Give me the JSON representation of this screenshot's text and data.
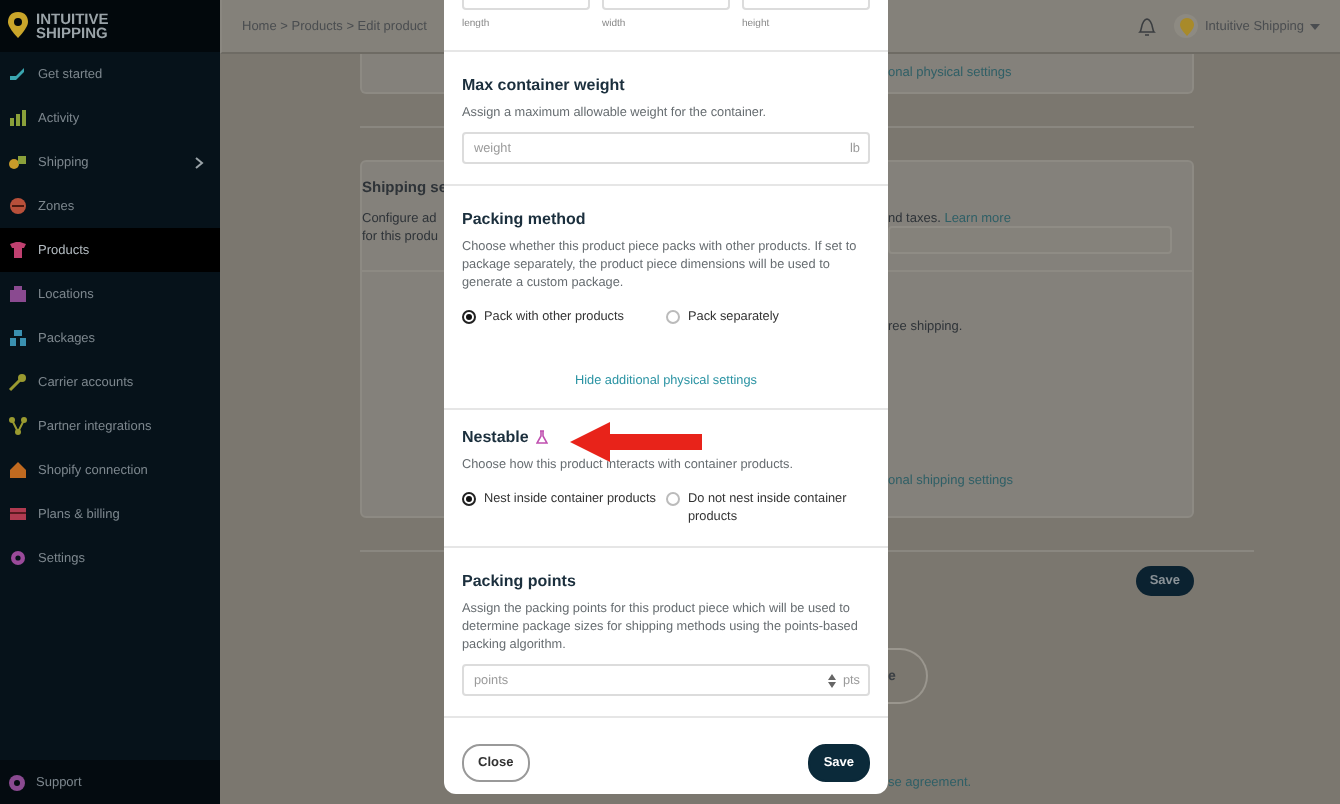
{
  "sidebar": {
    "logo": "INTUITIVE SHIPPING",
    "items": [
      {
        "label": "Get started",
        "selected": false,
        "submenu": false
      },
      {
        "label": "Activity",
        "selected": false,
        "submenu": false
      },
      {
        "label": "Shipping",
        "selected": false,
        "submenu": true
      },
      {
        "label": "Zones",
        "selected": false,
        "submenu": false
      },
      {
        "label": "Products",
        "selected": true,
        "submenu": false
      },
      {
        "label": "Locations",
        "selected": false,
        "submenu": false
      },
      {
        "label": "Packages",
        "selected": false,
        "submenu": false
      },
      {
        "label": "Carrier accounts",
        "selected": false,
        "submenu": false
      },
      {
        "label": "Partner integrations",
        "selected": false,
        "submenu": false
      },
      {
        "label": "Shopify connection",
        "selected": false,
        "submenu": false
      },
      {
        "label": "Plans & billing",
        "selected": false,
        "submenu": false
      },
      {
        "label": "Settings",
        "selected": false,
        "submenu": false
      }
    ],
    "support": "Support"
  },
  "top_bar": {
    "breadcrumb": "Home > Products > Edit product",
    "account": "Intuitive Shipping"
  },
  "background_page": {
    "physical_link": "onal physical settings",
    "heading": "Shipping se",
    "description_lines": [
      "Configure ad",
      "for this produ"
    ],
    "taxes_text": "nd taxes.",
    "learn_more": "Learn more",
    "free_shipping_text": "ree shipping.",
    "shipping_link": "onal shipping settings",
    "save": "Save",
    "round_button": "e",
    "agreement_link": "se agreement."
  },
  "modal": {
    "dimension_labels": [
      "length",
      "width",
      "height"
    ],
    "max_weight": {
      "title": "Max container weight",
      "description": "Assign a maximum allowable weight for the container.",
      "placeholder": "weight",
      "unit": "lb"
    },
    "packing_method": {
      "title": "Packing method",
      "description": "Choose whether this product piece packs with other products. If set to package separately, the product piece dimensions will be used to generate a custom package.",
      "options": [
        {
          "label": "Pack with other products",
          "selected": true
        },
        {
          "label": "Pack separately",
          "selected": false
        }
      ],
      "link": "Hide additional physical settings"
    },
    "nestable": {
      "title": "Nestable",
      "description": "Choose how this product interacts with container products.",
      "options": [
        {
          "label": "Nest inside container products",
          "selected": true
        },
        {
          "label": "Do not nest inside container products",
          "selected": false
        }
      ]
    },
    "packing_points": {
      "title": "Packing points",
      "description": "Assign the packing points for this product piece which will be used to determine package sizes for shipping methods using the points-based packing algorithm.",
      "placeholder": "points",
      "unit": "pts"
    },
    "close": "Close",
    "save": "Save"
  }
}
